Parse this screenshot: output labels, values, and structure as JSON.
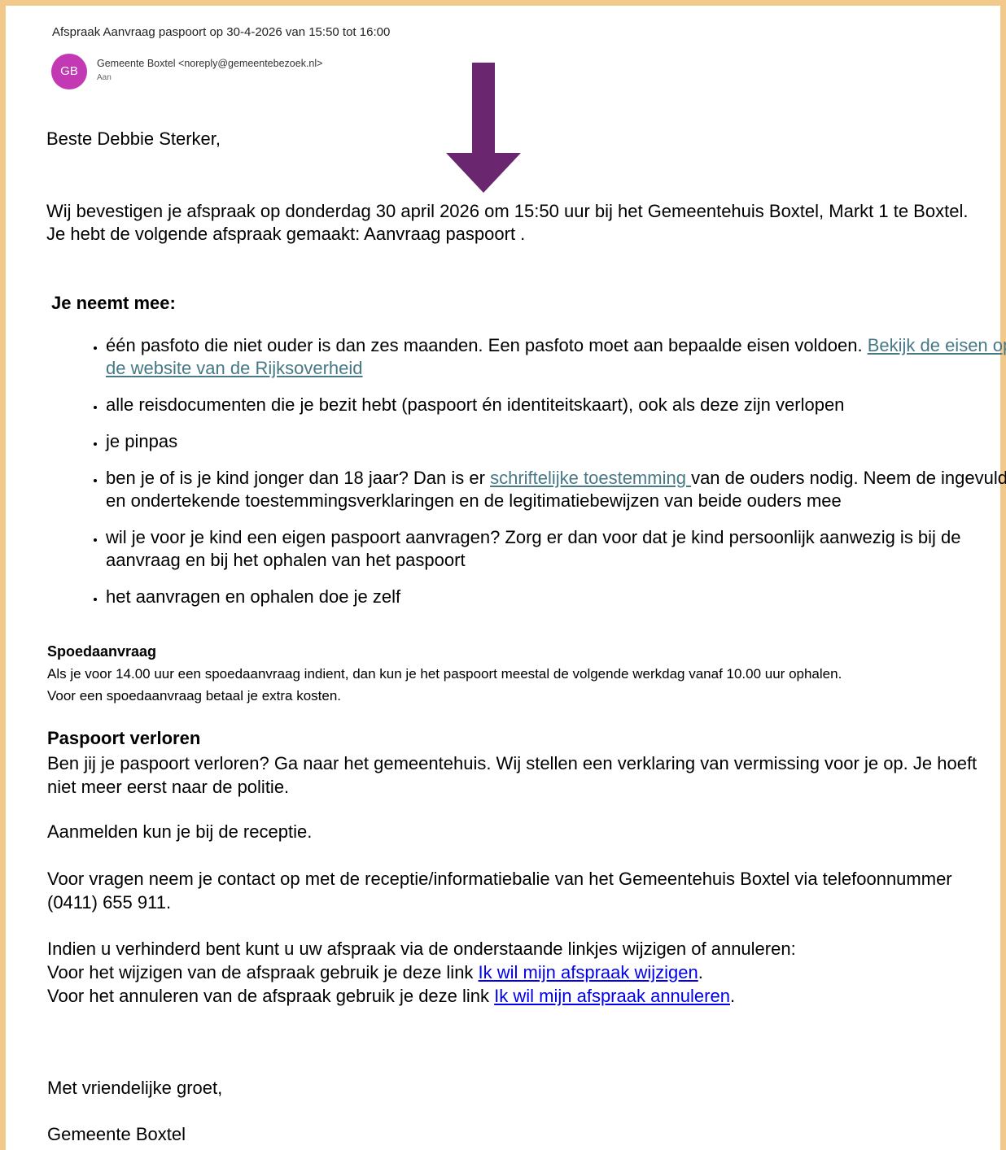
{
  "header": {
    "subject": "Afspraak Aanvraag paspoort  op 30-4-2026 van 15:50 tot 16:00",
    "avatar_initials": "GB",
    "avatar_color": "#c239b3",
    "sender": "Gemeente Boxtel <noreply@gemeentebezoek.nl>",
    "to_label": "Aan"
  },
  "annotation": {
    "arrow_color": "#6b2670",
    "arrow_icon": "down-arrow-icon"
  },
  "body": {
    "greeting": "Beste Debbie Sterker,",
    "confirm_line1": "Wij bevestigen je afspraak op donderdag 30 april 2026 om 15:50 uur bij het Gemeentehuis Boxtel, Markt 1 te Boxtel.",
    "confirm_line2": "Je hebt de volgende afspraak gemaakt: Aanvraag paspoort .",
    "bring_heading": "Je neemt mee:",
    "items": [
      {
        "text": "één pasfoto die niet ouder is dan zes maanden. Een pasfoto moet aan bepaalde eisen voldoen. ",
        "link": "Bekijk de eisen op de website van de Rijksoverheid"
      },
      {
        "text": "alle reisdocumenten die je bezit hebt (paspoort én identiteitskaart), ook als deze zijn verlopen"
      },
      {
        "text": "je pinpas"
      },
      {
        "pre": "ben je of is je kind jonger dan 18 jaar? Dan is er ",
        "link": "schriftelijke toestemming ",
        "post": "van de ouders nodig.  Neem de ingevulde en ondertekende toestemmingsverklaringen en de legitimatiebewijzen van beide ouders mee"
      },
      {
        "text": "wil je voor je kind een eigen paspoort aanvragen? Zorg er dan voor dat je kind persoonlijk aanwezig is bij de aanvraag en bij het ophalen van het paspoort"
      },
      {
        "text": "het aanvragen en ophalen doe je zelf"
      }
    ],
    "spoed_title": "Spoedaanvraag",
    "spoed_line1": "Als je voor 14.00 uur een spoedaanvraag indient, dan kun je het paspoort meestal de volgende werkdag vanaf 10.00 uur ophalen.",
    "spoed_line2": "Voor een spoedaanvraag betaal je extra kosten.",
    "lost_title": "Paspoort verloren",
    "lost_text": "Ben jij je paspoort verloren? Ga naar het gemeentehuis. Wij stellen een verklaring van vermissing voor je op. Je hoeft niet meer eerst naar de politie.",
    "register": "Aanmelden kun je bij de receptie.",
    "questions": "Voor vragen neem je contact op met de receptie/informatiebalie van het Gemeentehuis Boxtel via telefoonnummer (0411) 655 911.",
    "change_intro": "Indien u verhinderd bent kunt u uw afspraak via de onderstaande linkjes wijzigen of annuleren:",
    "change_pre": "Voor het wijzigen van de afspraak gebruik je deze link  ",
    "change_link": "Ik wil mijn afspraak wijzigen",
    "cancel_pre": "Voor het annuleren van de afspraak gebruik je deze link ",
    "cancel_link": "Ik wil mijn afspraak annuleren",
    "period": ".",
    "closing": "Met vriendelijke groet,",
    "signature": "Gemeente Boxtel"
  }
}
